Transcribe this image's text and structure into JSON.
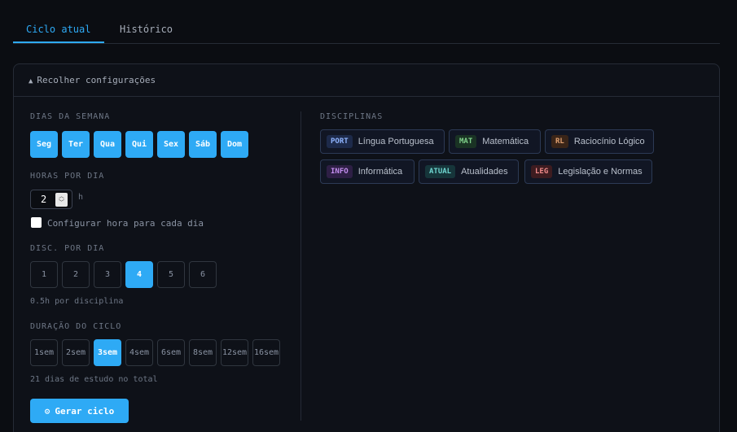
{
  "tabs": [
    {
      "label": "Ciclo atual",
      "active": true
    },
    {
      "label": "Histórico",
      "active": false
    }
  ],
  "panel": {
    "header_icon": "▲",
    "header_label": "Recolher configurações"
  },
  "days": {
    "label": "DIAS DA SEMANA",
    "items": [
      "Seg",
      "Ter",
      "Qua",
      "Qui",
      "Sex",
      "Sáb",
      "Dom"
    ]
  },
  "hours": {
    "label": "HORAS POR DIA",
    "value": "2",
    "unit": "h",
    "per_day_checkbox_label": "Configurar hora para cada dia",
    "per_day_checked": false
  },
  "disc_per_day": {
    "label": "DISC. POR DIA",
    "options": [
      "1",
      "2",
      "3",
      "4",
      "5",
      "6"
    ],
    "selected": "4",
    "hint": "0.5h por disciplina"
  },
  "cycle_duration": {
    "label": "DURAÇÃO DO CICLO",
    "options": [
      "1sem",
      "2sem",
      "3sem",
      "4sem",
      "6sem",
      "8sem",
      "12sem",
      "16sem"
    ],
    "selected": "3sem",
    "hint": "21 dias de estudo no total"
  },
  "generate_button": {
    "icon": "⚙",
    "label": "Gerar ciclo"
  },
  "disciplines": {
    "label": "DISCIPLINAS",
    "items": [
      {
        "code": "PORT",
        "name": "Língua Portuguesa",
        "code_color": "#8fb4ff",
        "code_bg": "#1d2a4a"
      },
      {
        "code": "MAT",
        "name": "Matemática",
        "code_color": "#7fd18a",
        "code_bg": "#1a3324"
      },
      {
        "code": "RL",
        "name": "Raciocínio Lógico",
        "code_color": "#e0a070",
        "code_bg": "#3a2518"
      },
      {
        "code": "INFO",
        "name": "Informática",
        "code_color": "#c48ef0",
        "code_bg": "#2e1f45"
      },
      {
        "code": "ATUAL",
        "name": "Atualidades",
        "code_color": "#6fd6d0",
        "code_bg": "#16353a"
      },
      {
        "code": "LEG",
        "name": "Legislação e Normas",
        "code_color": "#f08a8a",
        "code_bg": "#3d1c20"
      }
    ]
  },
  "colors": {
    "accent": "#2eaaf5",
    "background": "#0b0d12",
    "border": "#262b36"
  }
}
